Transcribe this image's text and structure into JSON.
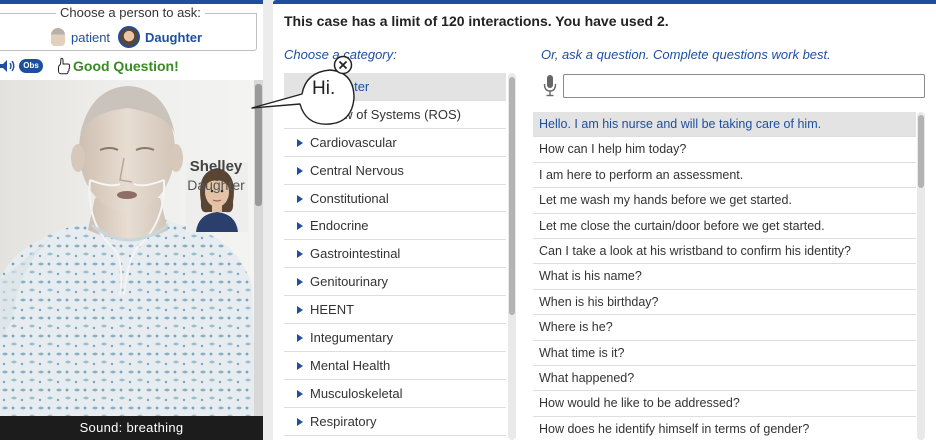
{
  "chooser": {
    "label": "Choose a person to ask:",
    "patient_label": "patient",
    "daughter_label": "Daughter"
  },
  "tools": {
    "speaker_icon": "speaker-icon",
    "obs_label": "Obs",
    "thumb_icon": "thumbs-up-icon",
    "good_question": "Good Question!"
  },
  "scene": {
    "speaker_name": "Shelley",
    "speaker_role": "Daughter",
    "sound_text": "Sound: breathing"
  },
  "bubble": {
    "text": "Hi."
  },
  "header": {
    "limit_text": "This case has a limit of 120 interactions. You have used 2."
  },
  "categories": {
    "heading": "Choose a category:",
    "items": [
      {
        "label": "Encounter",
        "has_arrow": false,
        "selected": true
      },
      {
        "label": "Review of Systems (ROS)",
        "has_arrow": false,
        "selected": false
      },
      {
        "label": "Cardiovascular",
        "has_arrow": true,
        "selected": false
      },
      {
        "label": "Central Nervous",
        "has_arrow": true,
        "selected": false
      },
      {
        "label": "Constitutional",
        "has_arrow": true,
        "selected": false
      },
      {
        "label": "Endocrine",
        "has_arrow": true,
        "selected": false
      },
      {
        "label": "Gastrointestinal",
        "has_arrow": true,
        "selected": false
      },
      {
        "label": "Genitourinary",
        "has_arrow": true,
        "selected": false
      },
      {
        "label": "HEENT",
        "has_arrow": true,
        "selected": false
      },
      {
        "label": "Integumentary",
        "has_arrow": true,
        "selected": false
      },
      {
        "label": "Mental Health",
        "has_arrow": true,
        "selected": false
      },
      {
        "label": "Musculoskeletal",
        "has_arrow": true,
        "selected": false
      },
      {
        "label": "Respiratory",
        "has_arrow": true,
        "selected": false
      }
    ]
  },
  "questions": {
    "heading": "Or, ask a question. Complete questions work best.",
    "input_value": "",
    "items": [
      {
        "text": "Hello. I am his nurse and will be taking care of him.",
        "selected": true
      },
      {
        "text": "How can I help him today?",
        "selected": false
      },
      {
        "text": "I am here to perform an assessment.",
        "selected": false
      },
      {
        "text": "Let me wash my hands before we get started.",
        "selected": false
      },
      {
        "text": "Let me close the curtain/door before we get started.",
        "selected": false
      },
      {
        "text": "Can I take a look at his wristband to confirm his identity?",
        "selected": false
      },
      {
        "text": "What is his name?",
        "selected": false
      },
      {
        "text": "When is his birthday?",
        "selected": false
      },
      {
        "text": "Where is he?",
        "selected": false
      },
      {
        "text": "What time is it?",
        "selected": false
      },
      {
        "text": "What happened?",
        "selected": false
      },
      {
        "text": "How would he like to be addressed?",
        "selected": false
      },
      {
        "text": "How does he identify himself in terms of gender?",
        "selected": false
      }
    ]
  },
  "colors": {
    "accent": "#1d4f9e",
    "good": "#3a8a26",
    "sound_bar": "#1c1c1c"
  }
}
